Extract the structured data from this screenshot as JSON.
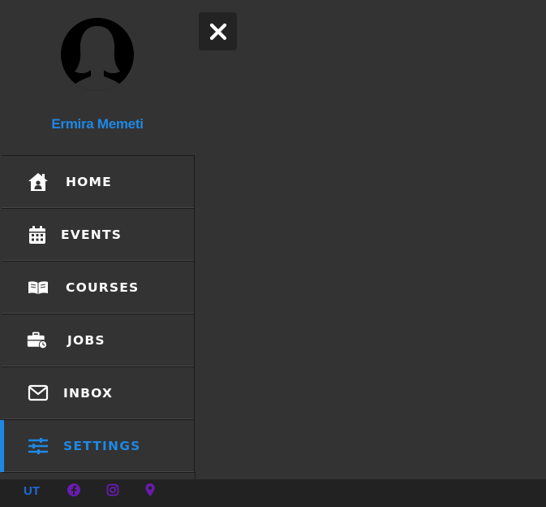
{
  "user": {
    "name": "Ermira Memeti"
  },
  "menu": {
    "items": [
      {
        "label": "HOME",
        "icon": "home-icon"
      },
      {
        "label": "EVENTS",
        "icon": "calendar-icon"
      },
      {
        "label": "COURSES",
        "icon": "open-book-icon"
      },
      {
        "label": "JOBS",
        "icon": "briefcase-clock-icon"
      },
      {
        "label": "INBOX",
        "icon": "envelope-icon"
      },
      {
        "label": "SETTINGS",
        "icon": "sliders-icon",
        "active": true
      }
    ]
  },
  "footer": {
    "brand": "UT",
    "social": [
      "facebook-icon",
      "instagram-icon",
      "location-pin-icon"
    ]
  },
  "colors": {
    "accent": "#1e88e5",
    "background": "#333333",
    "footer": "#222222",
    "social": "#6a1bb0"
  }
}
